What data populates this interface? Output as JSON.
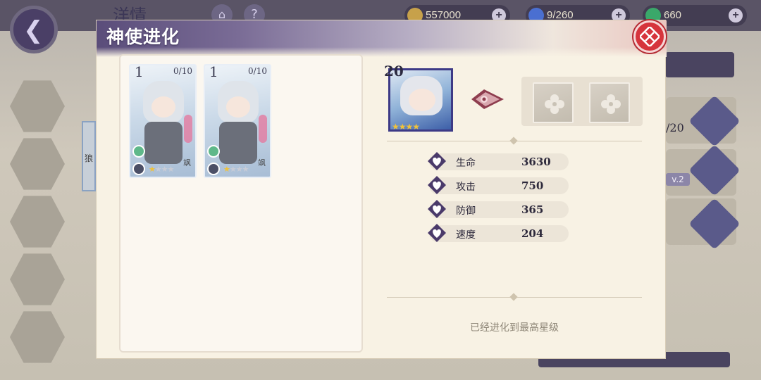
{
  "background": {
    "title": "洋情",
    "resources": [
      {
        "value": "557000",
        "icon": "coin-icon",
        "color": "#c7a14a"
      },
      {
        "value": "9/260",
        "icon": "energy-icon",
        "color": "#4a6fd1"
      },
      {
        "value": "660",
        "icon": "gem-icon",
        "color": "#3aa86a"
      }
    ],
    "side_texts": [
      "/20",
      "v.2"
    ],
    "left_clip_text": "狼"
  },
  "modal": {
    "title": "神使进化",
    "close_icon": "close-icon"
  },
  "material_list": [
    {
      "level": "1",
      "count": "0/10",
      "stars_on": 1,
      "stars_total": 4,
      "tag": "飒"
    },
    {
      "level": "1",
      "count": "0/10",
      "stars_on": 1,
      "stars_total": 4,
      "tag": "飒"
    }
  ],
  "hero": {
    "level": "20",
    "stars": 4
  },
  "stats": [
    {
      "label": "生命",
      "value": "3630"
    },
    {
      "label": "攻击",
      "value": "750"
    },
    {
      "label": "防御",
      "value": "365"
    },
    {
      "label": "速度",
      "value": "204"
    }
  ],
  "max_note": "已经进化到最高星级",
  "colors": {
    "accent": "#3d3a86",
    "close": "#d6343c",
    "panel": "#f8f2e4"
  }
}
